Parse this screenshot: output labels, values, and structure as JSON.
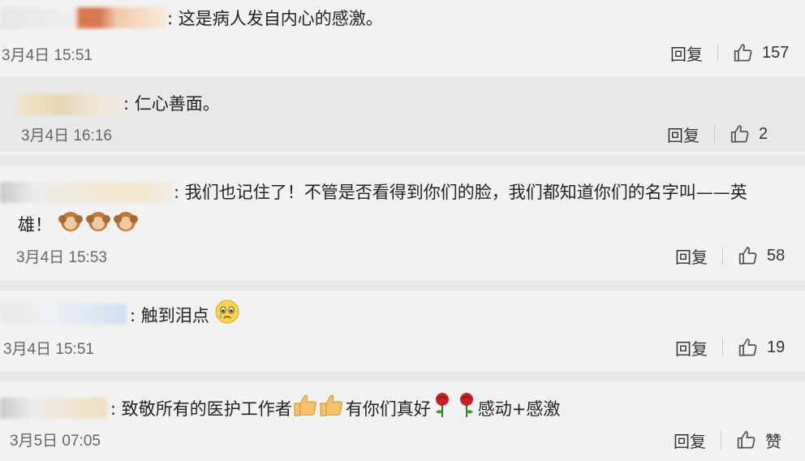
{
  "colors": {
    "card_bg": "#f2f2f2",
    "reply_bg": "#e8e8e8",
    "text": "#222222",
    "muted": "#666666"
  },
  "comments": [
    {
      "sep": ":",
      "text": "这是病人发自内心的感激。",
      "time": "3月4日 15:51",
      "reply_label": "回复",
      "likes": "157"
    },
    {
      "sep": ":",
      "text": "仁心善面。",
      "time": "3月4日 16:16",
      "reply_label": "回复",
      "likes": "2"
    },
    {
      "sep": ":",
      "text": "我们也记住了！不管是否看得到你们的脸，我们都知道你们的名字叫——英",
      "text2": "雄！",
      "time": "3月4日 15:53",
      "reply_label": "回复",
      "likes": "58"
    },
    {
      "sep": ":",
      "text": "触到泪点",
      "time": "3月4日 15:51",
      "reply_label": "回复",
      "likes": "19"
    },
    {
      "sep": ":",
      "text_a": "致敬所有的医护工作者",
      "text_b": "有你们真好",
      "text_c": "感动+感激",
      "time": "3月5日 07:05",
      "reply_label": "回复",
      "likes": "赞"
    }
  ]
}
